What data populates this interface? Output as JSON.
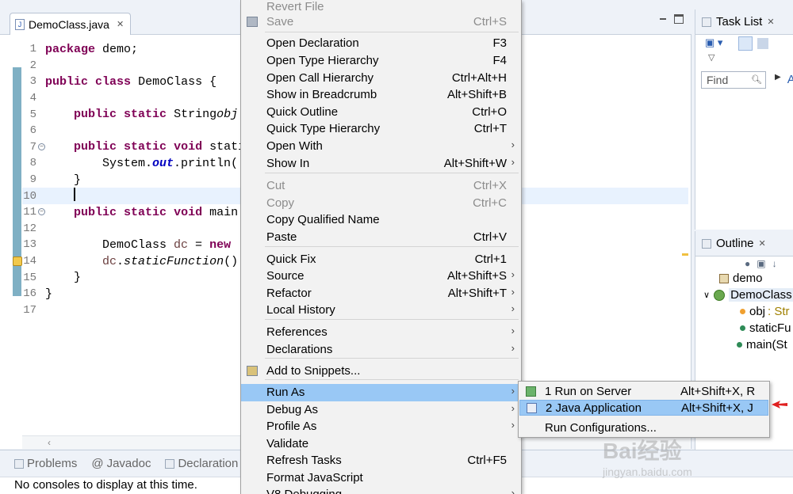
{
  "editor": {
    "tab_label": "DemoClass.java",
    "lines": [
      {
        "n": "1",
        "tokens": [
          [
            "kw",
            "package"
          ],
          [
            "",
            "demo;"
          ]
        ]
      },
      {
        "n": "2",
        "tokens": []
      },
      {
        "n": "3",
        "tokens": [
          [
            "kw",
            "public"
          ],
          [
            "kw",
            "class"
          ],
          [
            "",
            "DemoClass {"
          ]
        ]
      },
      {
        "n": "4",
        "tokens": []
      },
      {
        "n": "5",
        "tokens": [
          [
            "",
            "    "
          ],
          [
            "kw",
            "public"
          ],
          [
            "kw",
            "static"
          ],
          [
            "",
            "String"
          ],
          [
            "ital",
            "obj"
          ]
        ]
      },
      {
        "n": "6",
        "tokens": []
      },
      {
        "n": "7",
        "tokens": [
          [
            "",
            "    "
          ],
          [
            "kw",
            "public"
          ],
          [
            "kw",
            "static"
          ],
          [
            "kw",
            "void"
          ],
          [
            "",
            "stati"
          ]
        ]
      },
      {
        "n": "8",
        "tokens": [
          [
            "",
            "        System."
          ],
          [
            "fld",
            "out"
          ],
          [
            "",
            ".println("
          ]
        ]
      },
      {
        "n": "9",
        "tokens": [
          [
            "",
            "    }"
          ]
        ]
      },
      {
        "n": "10",
        "tokens": []
      },
      {
        "n": "11",
        "tokens": [
          [
            "",
            "    "
          ],
          [
            "kw",
            "public"
          ],
          [
            "kw",
            "static"
          ],
          [
            "kw",
            "void"
          ],
          [
            "",
            "main"
          ]
        ]
      },
      {
        "n": "12",
        "tokens": []
      },
      {
        "n": "13",
        "tokens": [
          [
            "",
            "        DemoClass "
          ],
          [
            "var",
            "dc"
          ],
          [
            "",
            " = "
          ],
          [
            "kw",
            "new"
          ],
          [
            "",
            " I"
          ]
        ]
      },
      {
        "n": "14",
        "tokens": [
          [
            "",
            "        "
          ],
          [
            "var",
            "dc"
          ],
          [
            "",
            "."
          ],
          [
            "ital",
            "staticFunction"
          ],
          [
            "",
            "()"
          ]
        ]
      },
      {
        "n": "15",
        "tokens": [
          [
            "",
            "    }"
          ]
        ]
      },
      {
        "n": "16",
        "tokens": [
          [
            "",
            "}"
          ]
        ]
      },
      {
        "n": "17",
        "tokens": []
      }
    ]
  },
  "bottom_panel": {
    "tabs": [
      "Problems",
      "Javadoc",
      "Declaration"
    ],
    "message": "No consoles to display at this time."
  },
  "task_list": {
    "title": "Task List",
    "find_placeholder": "Find",
    "filter_label": "A"
  },
  "outline": {
    "title": "Outline",
    "items": [
      {
        "label": "demo"
      },
      {
        "label": "DemoClass"
      },
      {
        "label": "obj",
        "type": ": Str"
      },
      {
        "label": "staticFu"
      },
      {
        "label": "main(St"
      }
    ]
  },
  "context_menu": {
    "items": [
      {
        "label": "Revert File",
        "shortcut": "",
        "disabled": true
      },
      {
        "label": "Save",
        "shortcut": "Ctrl+S",
        "disabled": true
      },
      {
        "label": "Open Declaration",
        "shortcut": "F3"
      },
      {
        "label": "Open Type Hierarchy",
        "shortcut": "F4"
      },
      {
        "label": "Open Call Hierarchy",
        "shortcut": "Ctrl+Alt+H"
      },
      {
        "label": "Show in Breadcrumb",
        "shortcut": "Alt+Shift+B"
      },
      {
        "label": "Quick Outline",
        "shortcut": "Ctrl+O"
      },
      {
        "label": "Quick Type Hierarchy",
        "shortcut": "Ctrl+T"
      },
      {
        "label": "Open With",
        "shortcut": ""
      },
      {
        "label": "Show In",
        "shortcut": "Alt+Shift+W"
      },
      {
        "label": "Cut",
        "shortcut": "Ctrl+X",
        "disabled": true
      },
      {
        "label": "Copy",
        "shortcut": "Ctrl+C",
        "disabled": true
      },
      {
        "label": "Copy Qualified Name",
        "shortcut": ""
      },
      {
        "label": "Paste",
        "shortcut": "Ctrl+V"
      },
      {
        "label": "Quick Fix",
        "shortcut": "Ctrl+1"
      },
      {
        "label": "Source",
        "shortcut": "Alt+Shift+S"
      },
      {
        "label": "Refactor",
        "shortcut": "Alt+Shift+T"
      },
      {
        "label": "Local History",
        "shortcut": ""
      },
      {
        "label": "References",
        "shortcut": ""
      },
      {
        "label": "Declarations",
        "shortcut": ""
      },
      {
        "label": "Add to Snippets...",
        "shortcut": ""
      },
      {
        "label": "Run As",
        "shortcut": ""
      },
      {
        "label": "Debug As",
        "shortcut": ""
      },
      {
        "label": "Profile As",
        "shortcut": ""
      },
      {
        "label": "Validate",
        "shortcut": ""
      },
      {
        "label": "Refresh Tasks",
        "shortcut": "Ctrl+F5"
      },
      {
        "label": "Format JavaScript",
        "shortcut": ""
      },
      {
        "label": "V8 Debugging",
        "shortcut": ""
      }
    ]
  },
  "run_as_submenu": {
    "items": [
      {
        "label": "1 Run on Server",
        "shortcut": "Alt+Shift+X, R"
      },
      {
        "label": "2 Java Application",
        "shortcut": "Alt+Shift+X, J"
      },
      {
        "label": "Run Configurations...",
        "shortcut": ""
      }
    ]
  },
  "watermark": {
    "brand": "Bai",
    "brand_cn": "经验",
    "url": "jingyan.baidu.com"
  },
  "colors": {
    "highlight": "#99c8f5",
    "keyword": "#7f0055",
    "field": "#0000c0",
    "menu_bg": "#f2f2f2"
  }
}
